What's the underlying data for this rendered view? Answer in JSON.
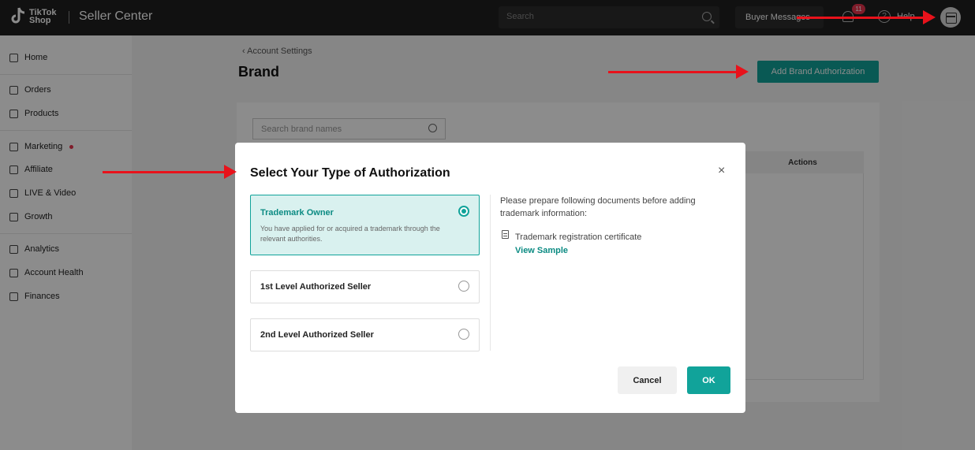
{
  "topbar": {
    "logo_line1": "TikTok",
    "logo_line2": "Shop",
    "app_title": "Seller Center",
    "search_placeholder": "Search",
    "buyer_messages": "Buyer Messages",
    "notification_count": "11",
    "help_label": "Help"
  },
  "sidebar": {
    "items": [
      {
        "label": "Home",
        "icon": "home-icon"
      },
      {
        "label": "Orders",
        "icon": "orders-icon"
      },
      {
        "label": "Products",
        "icon": "products-icon"
      },
      {
        "label": "Marketing",
        "icon": "megaphone-icon"
      },
      {
        "label": "Affiliate",
        "icon": "people-icon"
      },
      {
        "label": "LIVE & Video",
        "icon": "video-icon"
      },
      {
        "label": "Growth",
        "icon": "growth-icon"
      },
      {
        "label": "Analytics",
        "icon": "chart-icon"
      },
      {
        "label": "Account Health",
        "icon": "shield-icon"
      },
      {
        "label": "Finances",
        "icon": "wallet-icon"
      }
    ]
  },
  "main": {
    "breadcrumb": "Account Settings",
    "page_title": "Brand",
    "add_button": "Add Brand Authorization",
    "search_placeholder": "Search brand names",
    "actions_header": "Actions"
  },
  "modal": {
    "title": "Select Your Type of Authorization",
    "options": [
      {
        "title": "Trademark Owner",
        "desc": "You have applied for or acquired a trademark through the relevant authorities.",
        "selected": true
      },
      {
        "title": "1st Level Authorized Seller",
        "selected": false
      },
      {
        "title": "2nd Level Authorized Seller",
        "selected": false
      }
    ],
    "prepare_text": "Please prepare following documents before adding trademark information:",
    "document_name": "Trademark registration certificate",
    "view_sample": "View Sample",
    "cancel_label": "Cancel",
    "ok_label": "OK"
  },
  "colors": {
    "accent": "#11a39a",
    "annotation": "#e8121b",
    "topbar": "#1f1f1f"
  }
}
